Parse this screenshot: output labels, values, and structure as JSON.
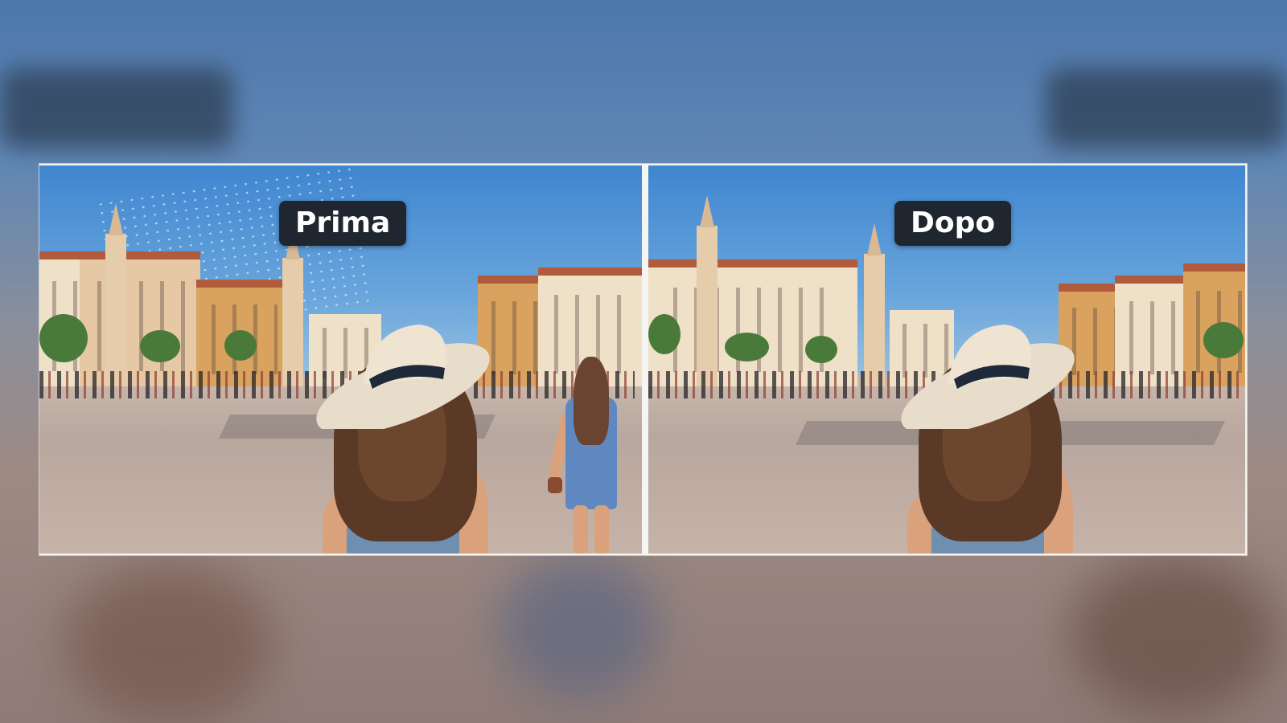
{
  "comparison": {
    "before_label": "Prima",
    "after_label": "Dopo"
  },
  "colors": {
    "label_background": "#1f2630",
    "label_text": "#ffffff",
    "frame": "#f4f2ee"
  }
}
